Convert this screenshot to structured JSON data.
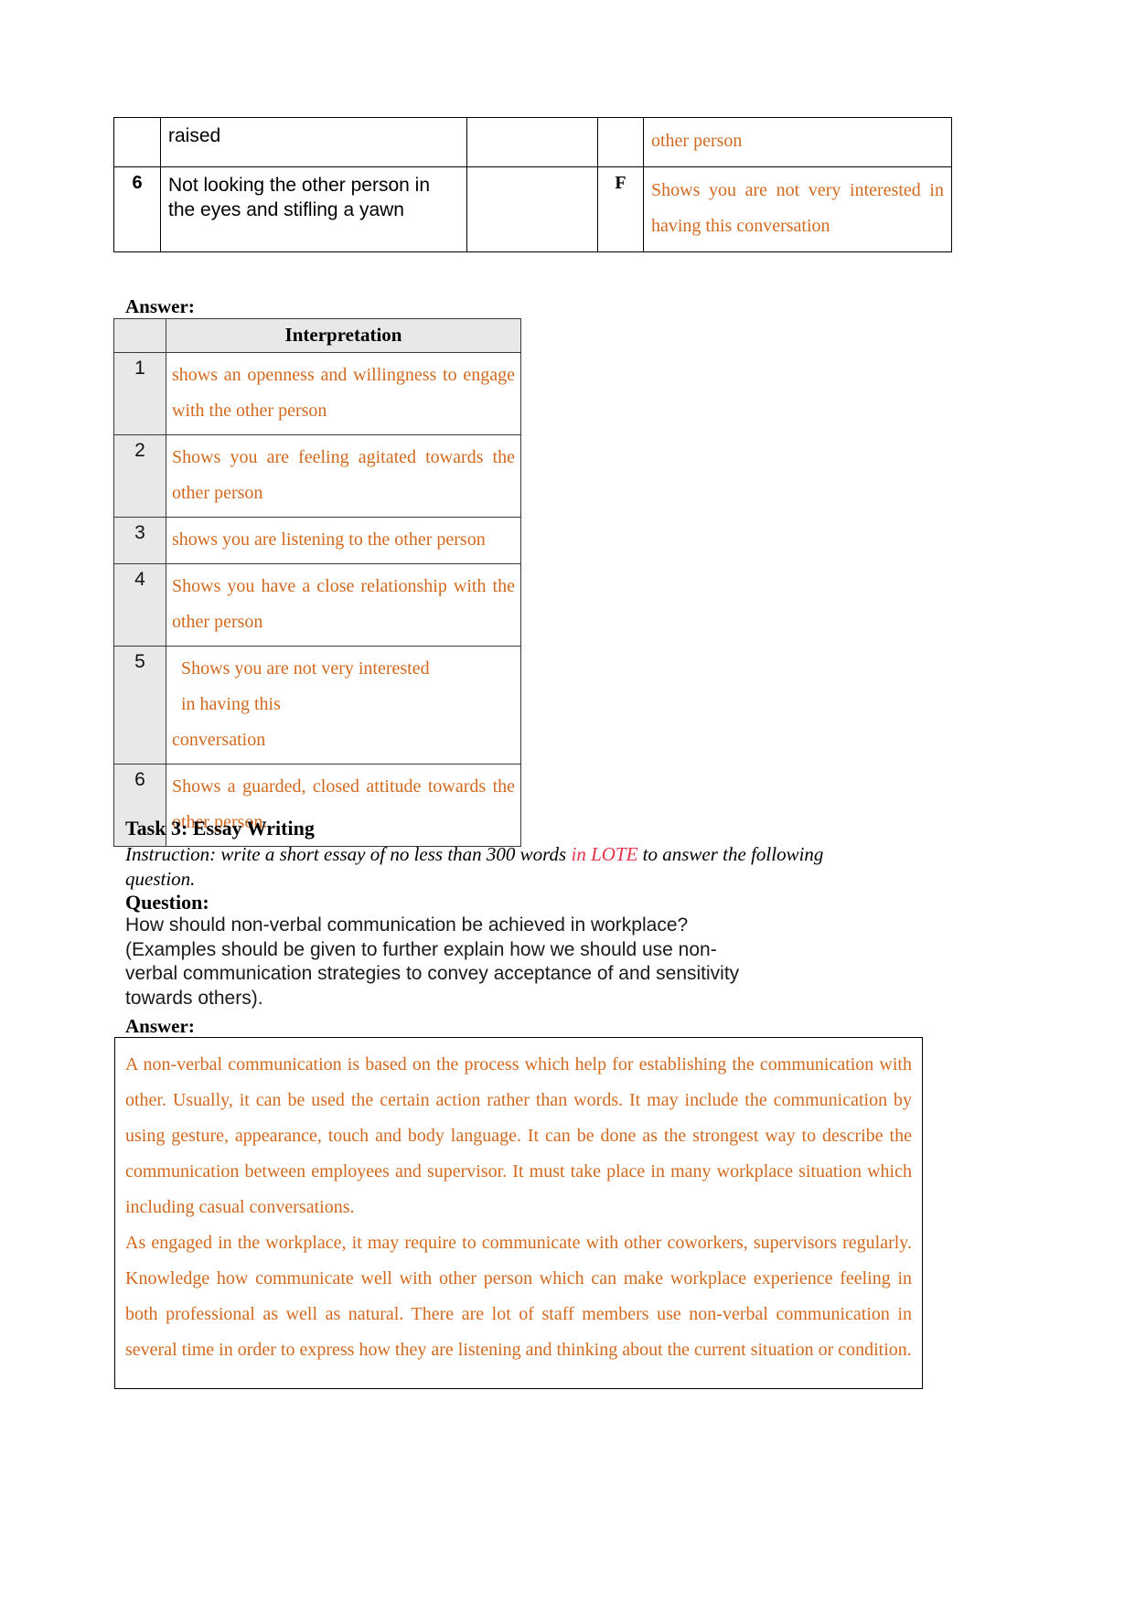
{
  "colors": {
    "handwritten_orange": "#D2691E",
    "lote_red": "#E8344A",
    "table_header_grey": "#e8e8e8",
    "text_black": "#000000"
  },
  "top_table": {
    "rows": [
      {
        "number": "",
        "behaviour": "raised",
        "blank": "",
        "letter": "",
        "interpretation": "other person"
      },
      {
        "number": "6",
        "behaviour": "Not looking the other person in the eyes and stifling a yawn",
        "blank": "",
        "letter": "F",
        "interpretation": "Shows you are not very interested in having this conversation"
      }
    ]
  },
  "answer_section_1": {
    "label": "Answer:",
    "table": {
      "header": {
        "number_col": "",
        "interpretation_col": "Interpretation"
      },
      "rows": [
        {
          "number": "1",
          "interpretation": "shows an openness and willingness to engage with the other person"
        },
        {
          "number": "2",
          "interpretation": "Shows you are feeling agitated towards the other person"
        },
        {
          "number": "3",
          "interpretation": "shows you are listening to the other person"
        },
        {
          "number": "4",
          "interpretation": "Shows you have a close relationship with the other person"
        },
        {
          "number": "5",
          "line1": "Shows you are not very interested",
          "line2": "in having this",
          "line3": "conversation"
        },
        {
          "number": "6",
          "interpretation": "Shows a guarded, closed attitude towards the other person."
        }
      ]
    }
  },
  "task3": {
    "heading": "Task 3: Essay Writing",
    "instruction_part1": "Instruction: write a short essay of no less than 300 words ",
    "instruction_lote": "in LOTE",
    "instruction_part2": " to answer the following question.",
    "question_label": "Question:",
    "question_line1": "How should non-verbal communication be achieved in workplace?",
    "question_line2": "(Examples should be given to further explain how we should use non-",
    "question_line3": "verbal communication strategies to convey acceptance of and sensitivity",
    "question_line4": "towards others)."
  },
  "answer_section_2": {
    "label": "Answer:",
    "essay": {
      "paragraph1": "A non-verbal communication is based on the process which help for establishing the communication with other. Usually, it can be used the certain action rather than words. It may include the communication by using gesture, appearance, touch and body language. It can be done as the strongest way to describe the communication between employees and supervisor. It must take place in many workplace situation which including casual conversations.",
      "paragraph2": "As engaged in the workplace, it may require to communicate with other coworkers, supervisors regularly. Knowledge how communicate well with other person which can make workplace experience feeling in both professional as well as natural. There are lot of staff members use non-verbal communication in several time in order to express how they are listening and thinking about the current situation or condition."
    }
  }
}
